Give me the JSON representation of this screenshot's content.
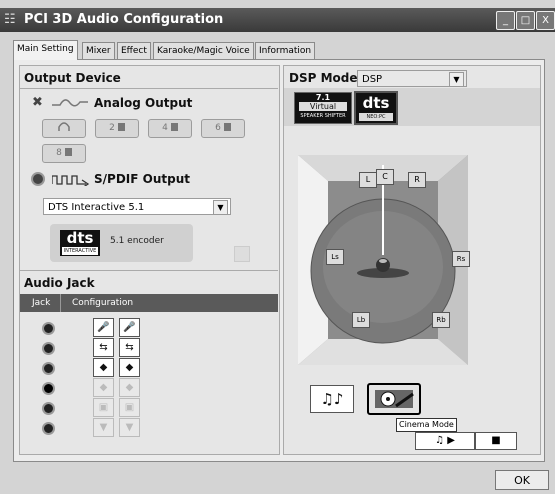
{
  "window": {
    "icon": "☷",
    "title": "PCI 3D Audio Configuration",
    "minimize": "_",
    "maximize": "□",
    "close": "X"
  },
  "tabs": [
    "Main Setting",
    "Mixer",
    "Effect",
    "Karaoke/Magic Voice",
    "Information"
  ],
  "output_device": {
    "title": "Output Device",
    "analog_label": "Analog Output",
    "channel_buttons": [
      "2",
      "4",
      "6",
      "8"
    ],
    "spdif_label": "S/PDIF Output",
    "spdif_select": "DTS Interactive 5.1",
    "dts_logo": "dts",
    "dts_sub": "INTERACTIVE",
    "encoder_label": "5.1 encoder"
  },
  "audio_jack": {
    "title": "Audio Jack",
    "col_jack": "Jack",
    "col_config": "Configuration"
  },
  "dsp": {
    "title": "DSP Mode",
    "select_value": "DSP",
    "badge_71_top": "7.1",
    "badge_71_mid": "Virtual",
    "badge_71_sub": "SPEAKER SHIFTER",
    "badge_dts": "dts",
    "badge_dts_sub": "NEO:PC",
    "speakers": [
      "L",
      "C",
      "R",
      "Ls",
      "Rs",
      "Lb",
      "Rb"
    ],
    "music_icon": "♫♪",
    "tooltip": "Cinema Mode",
    "play_icon": "♫ ▶",
    "stop_icon": "■"
  },
  "ok_button": "OK"
}
